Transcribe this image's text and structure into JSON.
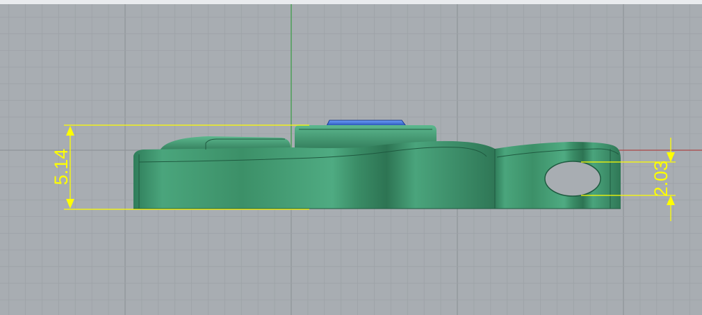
{
  "viewport": {
    "grid_visible": true,
    "background_color": "#a8adb2",
    "grid_minor_color": "#9da2a7",
    "grid_major_color": "#8f9499",
    "x_axis_color": "#b0494a",
    "y_axis_color": "#3aa046"
  },
  "model": {
    "body_color": "#3f9a72",
    "gem_color": "#2f63c6",
    "edge_color": "#1f5a40"
  },
  "dimensions": {
    "color": "#ffff00",
    "overall_height": {
      "text": "5.14"
    },
    "hole_height": {
      "text": "2.03"
    }
  }
}
